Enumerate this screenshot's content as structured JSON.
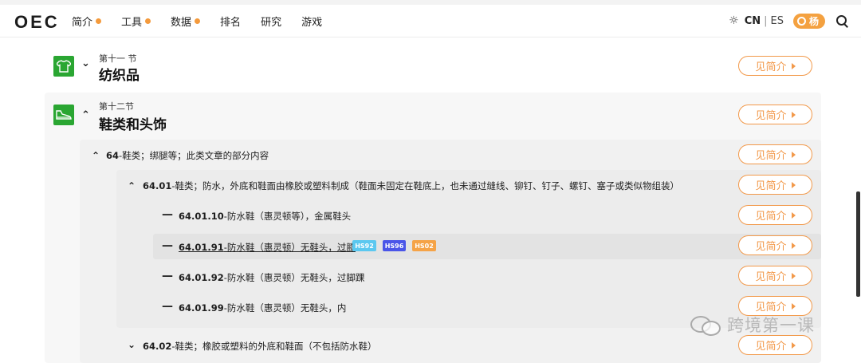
{
  "header": {
    "logo": "OEC",
    "nav": [
      {
        "label": "简介",
        "dot": true
      },
      {
        "label": "工具",
        "dot": true
      },
      {
        "label": "数据",
        "dot": true
      },
      {
        "label": "排名",
        "dot": false
      },
      {
        "label": "研究",
        "dot": false
      },
      {
        "label": "游戏",
        "dot": false
      }
    ],
    "lang_cn": "CN",
    "lang_sep": "|",
    "lang_es": "ES",
    "user_name": "杨",
    "icons": {
      "theme": "sun-icon",
      "user": "user-icon",
      "search": "search-icon"
    }
  },
  "sections": {
    "s11": {
      "sub": "第十一 节",
      "title": "纺织品",
      "chevron": "⌄"
    },
    "s12": {
      "sub": "第十二节",
      "title": "鞋类和头饰",
      "chevron": "⌃"
    }
  },
  "rows": {
    "h64": {
      "code": "64",
      "text": "-鞋类；绑腿等；此类文章的部分内容",
      "chevron": "⌃"
    },
    "h6401": {
      "code": "64.01",
      "text": "-鞋类；防水，外底和鞋面由橡胶或塑料制成（鞋面未固定在鞋底上，也未通过缝线、铆钉、钉子、螺钉、塞子或类似物组装）",
      "chevron": "⌃"
    },
    "r640110": {
      "code": "64.01.10",
      "text": "-防水鞋（惠灵顿等），金属鞋头",
      "dash": "—"
    },
    "r640191": {
      "code": "64.01.91",
      "text": "-防水鞋（惠灵顿）无鞋头，过膝",
      "dash": "—"
    },
    "r640192": {
      "code": "64.01.92",
      "text": "-防水鞋（惠灵顿）无鞋头，过脚踝",
      "dash": "—"
    },
    "r640199": {
      "code": "64.01.99",
      "text": "-防水鞋（惠灵顿）无鞋头，内",
      "dash": "—"
    },
    "h6402": {
      "code": "64.02",
      "text": "-鞋类；橡胶或塑料的外底和鞋面（不包括防水鞋）",
      "chevron": "⌄"
    }
  },
  "badges": [
    {
      "label": "HS92",
      "color": "#5bc8f0"
    },
    {
      "label": "HS96",
      "color": "#4a55e8"
    },
    {
      "label": "HS02",
      "color": "#f5a347"
    }
  ],
  "button_label": "见简介",
  "colors": {
    "accent": "#f2994a",
    "section_icon": "#2aa632"
  },
  "watermark": "跨境第一课"
}
